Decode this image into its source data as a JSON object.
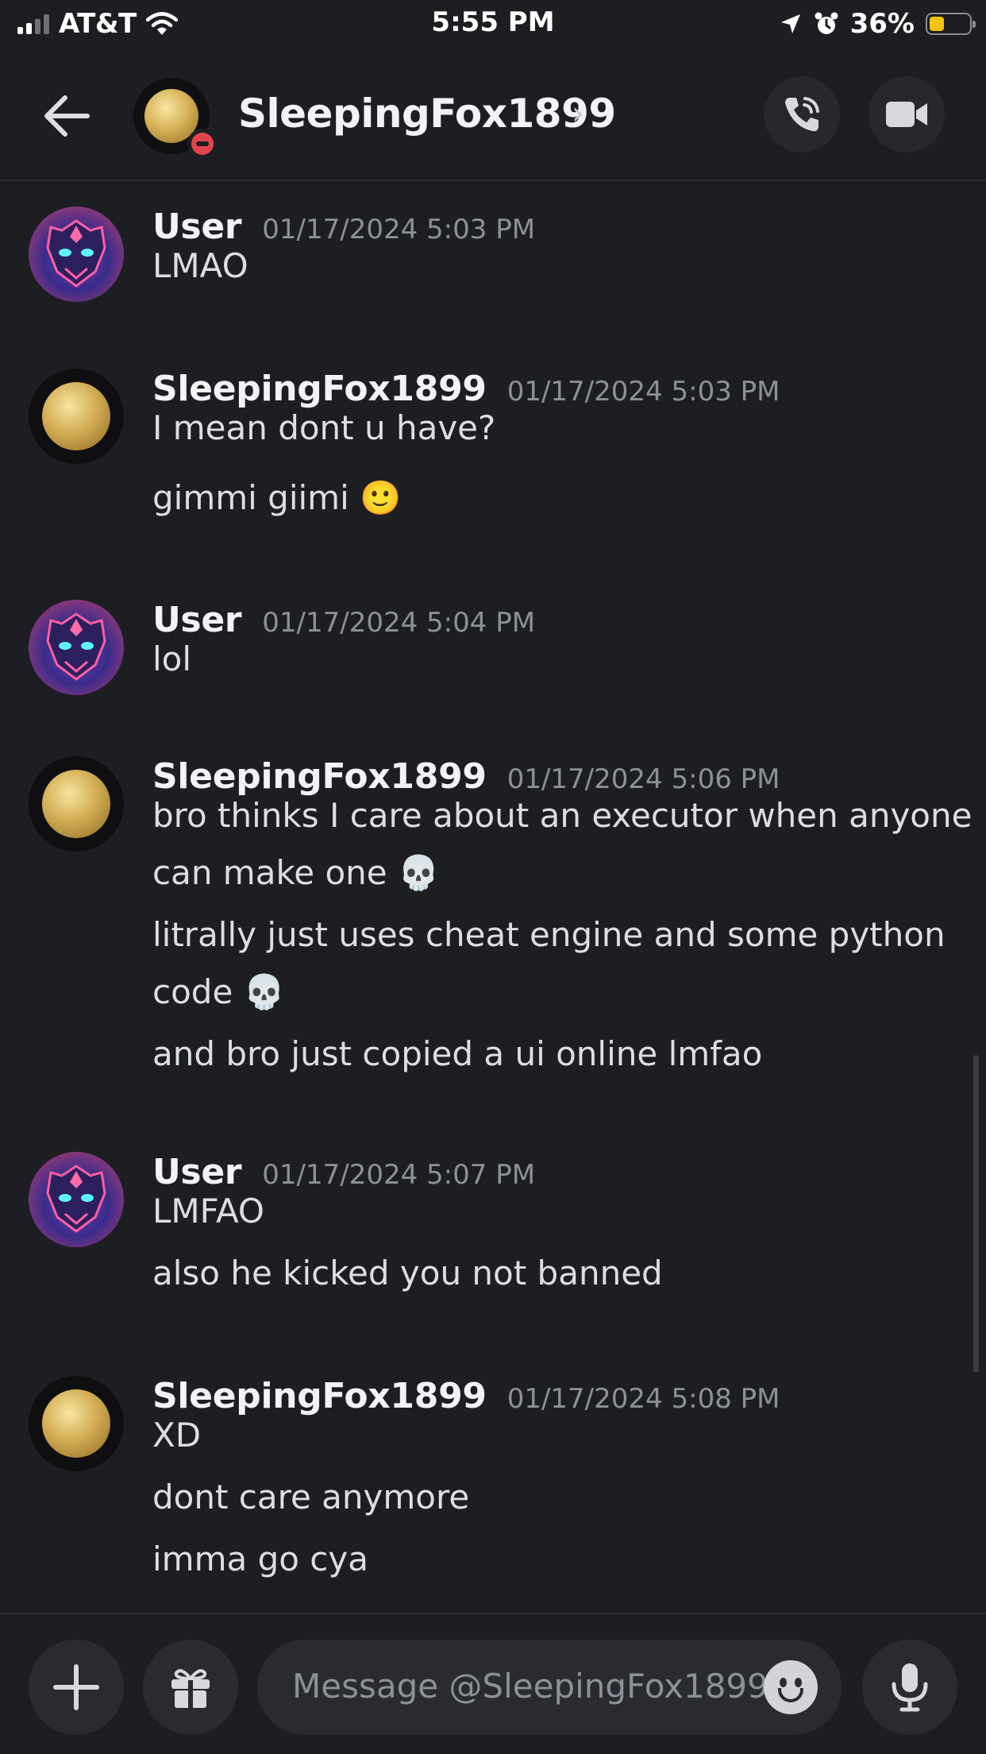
{
  "status_bar": {
    "carrier": "AT&T",
    "time": "5:55 PM",
    "battery": "36%",
    "battery_level": 0.36,
    "icons": [
      "signal-icon",
      "wifi-icon",
      "location-arrow-icon",
      "alarm-icon",
      "battery-icon"
    ]
  },
  "header": {
    "name": "SleepingFox1899",
    "chevron": "›",
    "status": "do-not-disturb",
    "buttons": [
      "back-arrow-icon",
      "phone-call-icon",
      "video-camera-icon"
    ]
  },
  "messages": [
    {
      "author": "User",
      "timestamp": "01/17/2024 5:03 PM",
      "lines": [
        "LMAO"
      ]
    },
    {
      "author": "SleepingFox1899",
      "timestamp": "01/17/2024 5:03 PM",
      "lines": [
        "I mean dont u have?",
        "gimmi giimi 🙂"
      ]
    },
    {
      "author": "User",
      "timestamp": "01/17/2024 5:04 PM",
      "lines": [
        "lol"
      ]
    },
    {
      "author": "SleepingFox1899",
      "timestamp": "01/17/2024 5:06 PM",
      "lines": [
        "bro thinks I care about an executor when anyone",
        "can make one 💀",
        "litrally just uses cheat engine and some python",
        "code 💀",
        "and bro just copied a ui online lmfao"
      ]
    },
    {
      "author": "User",
      "timestamp": "01/17/2024 5:07 PM",
      "lines": [
        "LMFAO",
        "also he kicked you not banned"
      ]
    },
    {
      "author": "SleepingFox1899",
      "timestamp": "01/17/2024 5:08 PM",
      "lines": [
        "XD",
        "dont care anymore",
        "imma go cya"
      ]
    }
  ],
  "composer": {
    "placeholder": "Message @SleepingFox1899",
    "buttons": [
      "plus-icon",
      "gift-icon",
      "emoji-icon",
      "microphone-icon"
    ]
  },
  "colors": {
    "background": "#1d1e22",
    "surface": "#2a2b30",
    "text": "#dcdee2",
    "muted": "#8d9097",
    "dnd_red": "#e2444a",
    "battery_yellow": "#f2c311"
  }
}
